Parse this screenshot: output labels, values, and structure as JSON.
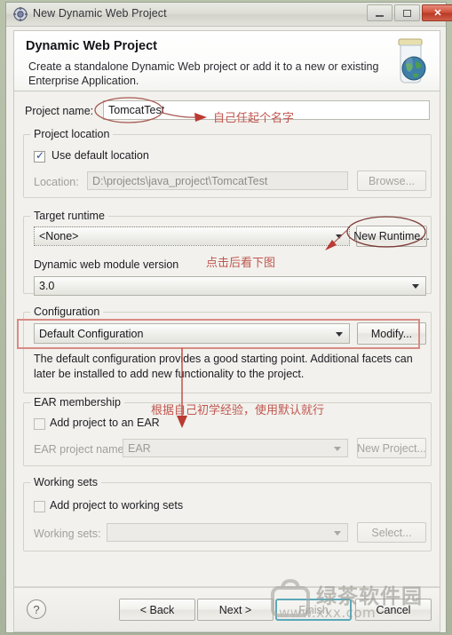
{
  "window": {
    "title": "New Dynamic Web Project",
    "icon": "wizard-gear-icon",
    "minimize_label": "",
    "maximize_label": "",
    "close_label": "✕"
  },
  "header": {
    "title": "Dynamic Web Project",
    "description": "Create a standalone Dynamic Web project or add it to a new or existing Enterprise Application.",
    "icon": "jar-with-globe-icon"
  },
  "form": {
    "project_name_label": "Project name:",
    "project_name_value": "TomcatTest",
    "project_location": {
      "group_title": "Project location",
      "use_default_label": "Use default location",
      "use_default_checked": true,
      "location_label": "Location:",
      "location_value": "D:\\projects\\java_project\\TomcatTest",
      "browse_label": "Browse..."
    },
    "target_runtime": {
      "group_title": "Target runtime",
      "value": "<None>",
      "new_runtime_label": "New Runtime..."
    },
    "module_version": {
      "label": "Dynamic web module version",
      "value": "3.0"
    },
    "configuration": {
      "group_title": "Configuration",
      "value": "Default Configuration",
      "modify_label": "Modify...",
      "description": "The default configuration provides a good starting point. Additional facets can later be installed to add new functionality to the project."
    },
    "ear_membership": {
      "group_title": "EAR membership",
      "add_project_label": "Add project to an EAR",
      "add_project_checked": false,
      "ear_name_label": "EAR project name:",
      "ear_name_value": "EAR",
      "new_project_label": "New Project..."
    },
    "working_sets": {
      "group_title": "Working sets",
      "add_to_working_sets_label": "Add project to working sets",
      "add_to_working_sets_checked": false,
      "working_sets_label": "Working sets:",
      "working_sets_value": "",
      "select_label": "Select..."
    }
  },
  "footer": {
    "help_label": "?",
    "back_label": "< Back",
    "next_label": "Next >",
    "finish_label": "Finish",
    "cancel_label": "Cancel"
  },
  "annotations": {
    "project_name_note": "自己任起个名字",
    "runtime_note": "点击后看下图",
    "ear_note": "根据自己初学经验，使用默认就行"
  },
  "watermark": {
    "site_name": "绿茶软件园",
    "site_url": "www.xxx.com"
  },
  "colors": {
    "annotation_red": "#c0564e",
    "highlight_box": "#d98b84",
    "close_button": "#c0402b",
    "focus_border": "#5aa8b8"
  }
}
